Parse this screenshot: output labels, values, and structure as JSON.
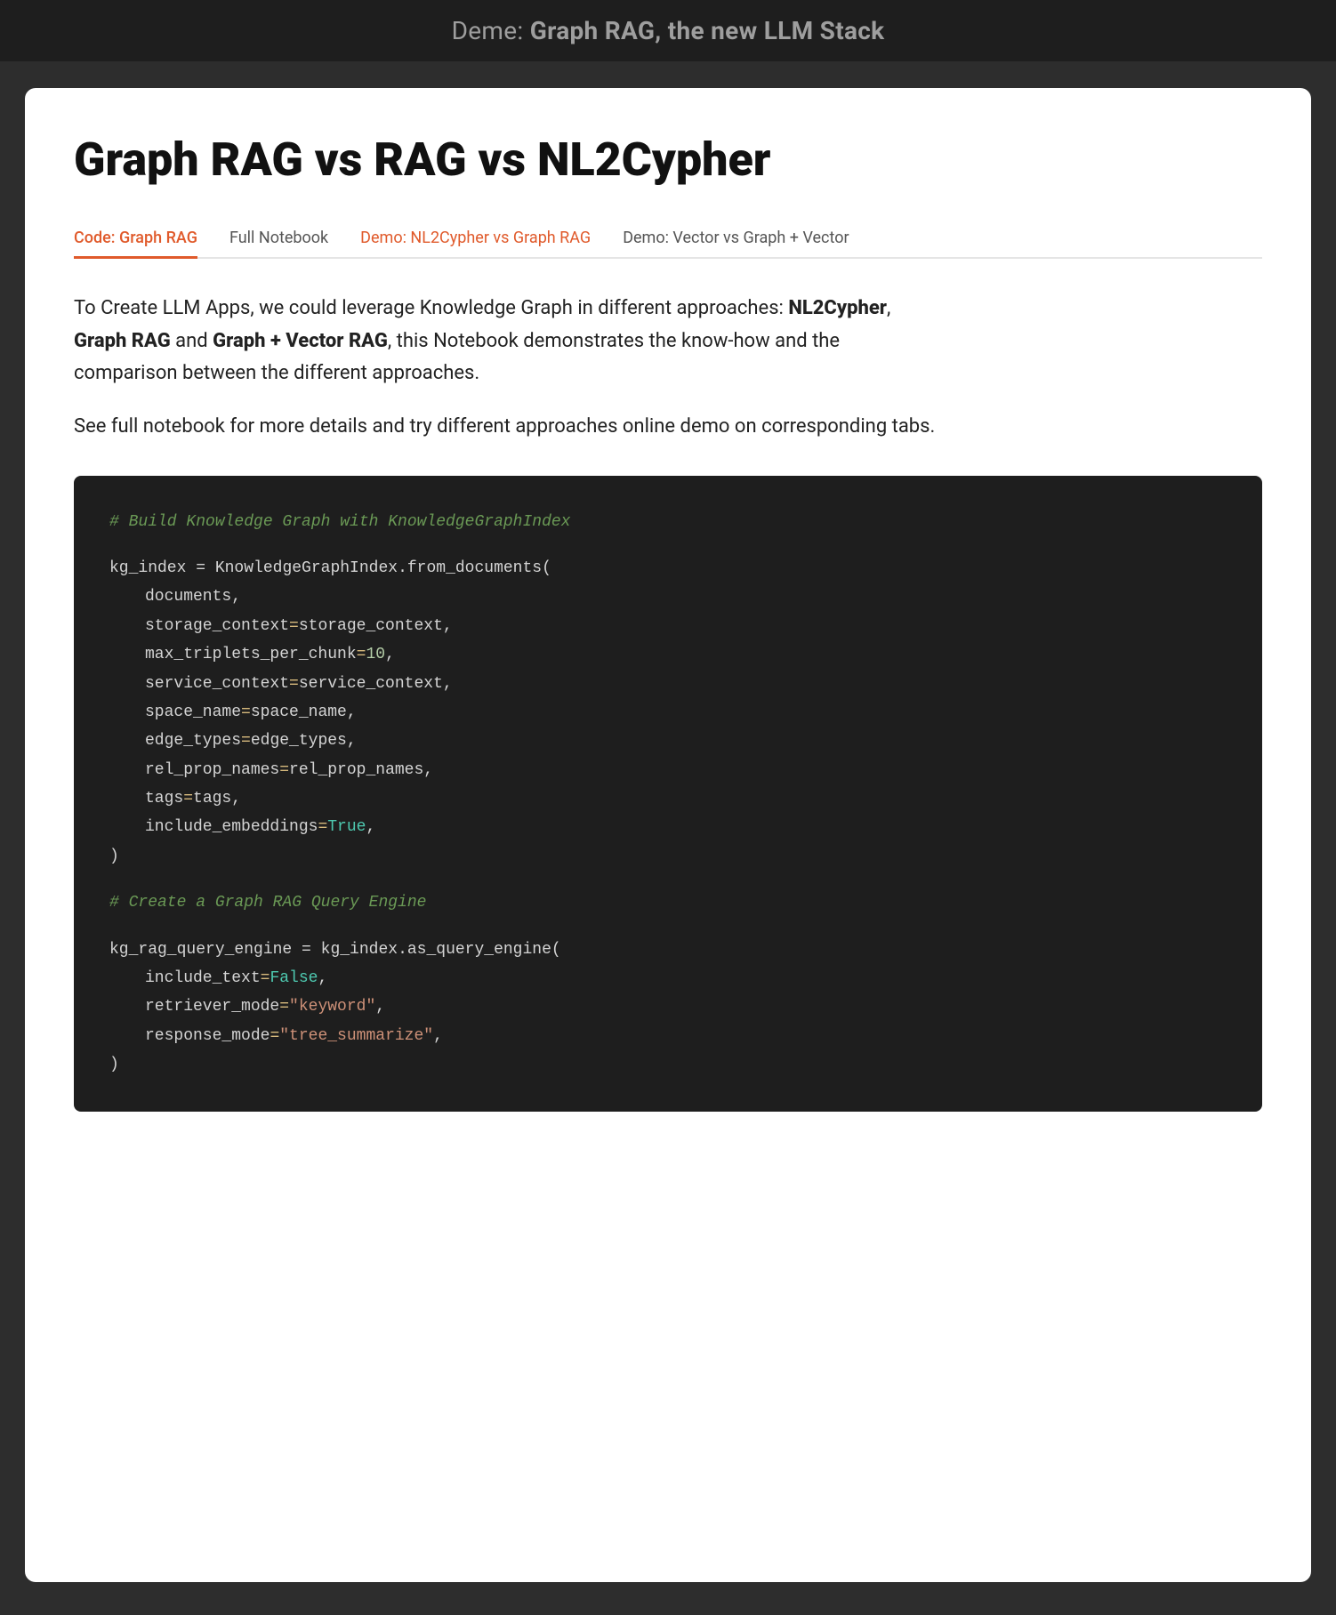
{
  "topbar": {
    "text": "Deme: Graph RAG, the new LLM Stack"
  },
  "page": {
    "title": "Graph RAG vs RAG vs NL2Cypher"
  },
  "tabs": [
    {
      "label": "Code: Graph RAG",
      "active": true,
      "demo": false
    },
    {
      "label": "Full Notebook",
      "active": false,
      "demo": false
    },
    {
      "label": "Demo: NL2Cypher vs Graph RAG",
      "active": false,
      "demo": true
    },
    {
      "label": "Demo: Vector vs Graph + Vector",
      "active": false,
      "demo": false
    }
  ],
  "description": {
    "part1": "To Create LLM Apps, we could leverage Knowledge Graph in different approaches: ",
    "bold1": "NL2Cypher",
    "sep1": ", ",
    "bold2": "Graph RAG",
    "part2": " and ",
    "bold3": "Graph + Vector RAG",
    "part3": ", this Notebook demonstrates the know-how and the comparison between the different approaches."
  },
  "see_full": "See full notebook for more details and try different approaches online demo on corresponding tabs.",
  "code": {
    "comment1": "# Build Knowledge Graph with KnowledgeGraphIndex",
    "block1": {
      "var": "kg_index",
      "assign": " = ",
      "class": "KnowledgeGraphIndex",
      "method": ".from_documents(",
      "params": [
        {
          "name": "documents",
          "value": null,
          "type": "plain"
        },
        {
          "name": "storage_context",
          "value": "storage_context",
          "type": "equals"
        },
        {
          "name": "max_triplets_per_chunk",
          "value": "10",
          "type": "number"
        },
        {
          "name": "service_context",
          "value": "service_context",
          "type": "equals"
        },
        {
          "name": "space_name",
          "value": "space_name",
          "type": "equals"
        },
        {
          "name": "edge_types",
          "value": "edge_types",
          "type": "equals"
        },
        {
          "name": "rel_prop_names",
          "value": "rel_prop_names",
          "type": "equals"
        },
        {
          "name": "tags",
          "value": "tags",
          "type": "equals"
        },
        {
          "name": "include_embeddings",
          "value": "True",
          "type": "bool_true"
        }
      ]
    },
    "comment2": "# Create a Graph RAG Query Engine",
    "block2": {
      "var": "kg_rag_query_engine",
      "assign": " = ",
      "class": "kg_index",
      "method": ".as_query_engine(",
      "params": [
        {
          "name": "include_text",
          "value": "False",
          "type": "bool_false"
        },
        {
          "name": "retriever_mode",
          "value": "\"keyword\"",
          "type": "string"
        },
        {
          "name": "response_mode",
          "value": "\"tree_summarize\"",
          "type": "string"
        }
      ]
    }
  }
}
